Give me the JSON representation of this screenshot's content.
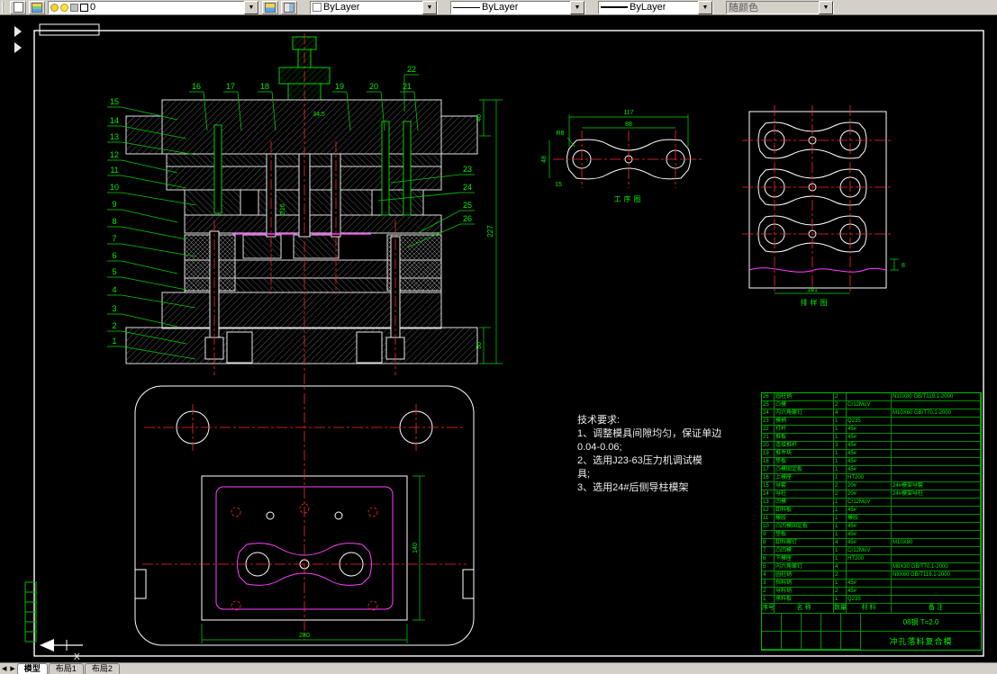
{
  "toolbar": {
    "layer_value": "0",
    "color_value": "ByLayer",
    "linetype_value": "ByLayer",
    "lineweight_value": "ByLayer",
    "plotstyle_value": "随颜色"
  },
  "tabs": [
    "模型",
    "布局1",
    "布局2"
  ],
  "statusbar": {
    "nav_left": "◀",
    "nav_right": "▶"
  },
  "drawing": {
    "labels": {
      "process": "工序图",
      "strip": "排样图"
    },
    "tech_req": {
      "title": "技术要求:",
      "lines": [
        "1、调整模具间隙均匀，保证单边",
        "0.04-0.06;",
        "2、选用J23-63压力机调试模",
        "具;",
        "3、选用24#后侧导柱模架"
      ]
    },
    "callouts": {
      "left": [
        "15",
        "14",
        "13",
        "12",
        "11",
        "10",
        "9",
        "8",
        "7",
        "6",
        "5",
        "4",
        "3",
        "2",
        "1"
      ],
      "top": [
        "16",
        "17",
        "18",
        "19",
        "20",
        "21",
        "22"
      ],
      "right": [
        "23",
        "24",
        "25",
        "26"
      ]
    },
    "dims": {
      "assembly_total": "227",
      "assembly_upper": "40",
      "assembly_lower": "50",
      "punch_dia": "Ø16",
      "shank": "34.5",
      "process_len": "117",
      "process_holes": "88",
      "process_r": "R8",
      "process_side": "15",
      "process_h": "48",
      "strip_w": "101",
      "strip_step": "8",
      "plan_w": "280",
      "plan_h": "140",
      "ucs_x": "X"
    },
    "bom": {
      "rows": [
        [
          "26",
          "圆柱销",
          "2",
          "",
          "N10X80 GB/T119.1-2000"
        ],
        [
          "25",
          "凸模",
          "2",
          "Cr12MoV",
          ""
        ],
        [
          "24",
          "内六角螺钉",
          "4",
          "",
          "M10X60 GB/T70.1-2000"
        ],
        [
          "23",
          "模柄",
          "1",
          "Q235",
          ""
        ],
        [
          "22",
          "打杆",
          "1",
          "45#",
          ""
        ],
        [
          "21",
          "推板",
          "1",
          "45#",
          ""
        ],
        [
          "20",
          "连接推杆",
          "3",
          "45#",
          ""
        ],
        [
          "19",
          "推件块",
          "1",
          "45#",
          ""
        ],
        [
          "18",
          "垫板",
          "1",
          "45#",
          ""
        ],
        [
          "17",
          "凸模固定板",
          "1",
          "45#",
          ""
        ],
        [
          "16",
          "上模座",
          "1",
          "HT200",
          ""
        ],
        [
          "15",
          "导套",
          "2",
          "20#",
          "24#模架导套"
        ],
        [
          "14",
          "导柱",
          "2",
          "20#",
          "24#模架导柱"
        ],
        [
          "13",
          "凹模",
          "1",
          "Cr12MoV",
          ""
        ],
        [
          "12",
          "卸料板",
          "1",
          "45#",
          ""
        ],
        [
          "11",
          "橡胶",
          "1",
          "橡胶",
          ""
        ],
        [
          "10",
          "凸凹模固定板",
          "1",
          "45#",
          ""
        ],
        [
          "9",
          "垫板",
          "1",
          "45#",
          ""
        ],
        [
          "8",
          "卸料螺钉",
          "4",
          "45#",
          "M10X80"
        ],
        [
          "7",
          "凸凹模",
          "1",
          "Cr12MoV",
          ""
        ],
        [
          "6",
          "下模座",
          "1",
          "HT200",
          ""
        ],
        [
          "5",
          "内六角螺钉",
          "4",
          "",
          "M8X30 GB/T70.1-2000"
        ],
        [
          "4",
          "圆柱销",
          "2",
          "",
          "N8X60 GB/T119.1-2000"
        ],
        [
          "3",
          "挡料销",
          "1",
          "45#",
          ""
        ],
        [
          "2",
          "导料销",
          "2",
          "45#",
          ""
        ],
        [
          "1",
          "承料板",
          "1",
          "Q235",
          ""
        ]
      ],
      "header": [
        "序号",
        "名 称",
        "数量",
        "材 料",
        "备 注"
      ],
      "material_note": "08钢  T=2.0",
      "title": "冲孔落料复合模"
    }
  }
}
